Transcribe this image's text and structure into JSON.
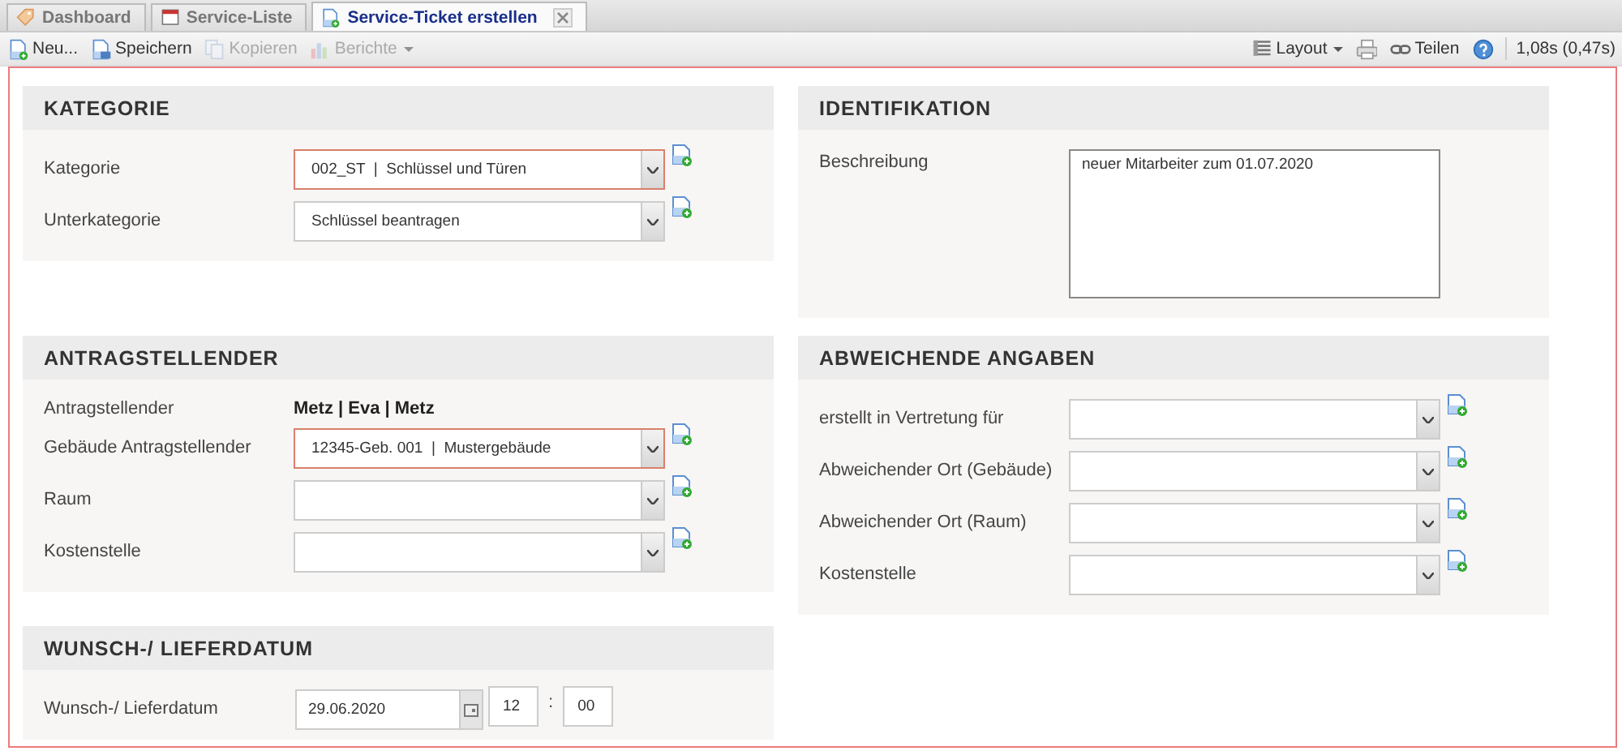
{
  "tabs": [
    {
      "label": "Dashboard",
      "selected": false,
      "kind": "tag"
    },
    {
      "label": "Service-Liste",
      "selected": false,
      "kind": "list"
    },
    {
      "label": "Service-Ticket erstellen",
      "selected": true,
      "kind": "new",
      "closable": true
    }
  ],
  "toolbar": {
    "left": [
      {
        "label": "Neu...",
        "kind": "new",
        "disabled": false,
        "dropdown": false
      },
      {
        "label": "Speichern",
        "kind": "save",
        "disabled": false,
        "dropdown": false
      },
      {
        "label": "Kopieren",
        "kind": "copy",
        "disabled": true,
        "dropdown": false
      },
      {
        "label": "Berichte",
        "kind": "chart",
        "disabled": true,
        "dropdown": true
      }
    ],
    "right": [
      {
        "label": "Layout",
        "kind": "layout",
        "disabled": false,
        "dropdown": true
      },
      {
        "kind": "print",
        "disabled": false,
        "dropdown": false
      },
      {
        "label": "Teilen",
        "kind": "link",
        "disabled": false,
        "dropdown": false
      },
      {
        "kind": "help",
        "disabled": false,
        "dropdown": false
      }
    ],
    "timing": "1,08s (0,47s)"
  },
  "form_rows": [
    [
      {
        "title": "KATEGORIE",
        "fields": [
          {
            "kind": "select",
            "label": "Kategorie",
            "value": "002_ST  |  Schlüssel und Türen",
            "required": true
          },
          {
            "kind": "select",
            "label": "Unterkategorie",
            "value": "Schlüssel beantragen",
            "required": false
          }
        ]
      },
      {
        "title": "IDENTIFIKATION",
        "fields": [
          {
            "kind": "textarea",
            "label": "Beschreibung",
            "value": "neuer Mitarbeiter zum 01.07.2020"
          }
        ]
      }
    ],
    [
      {
        "title": "ANTRAGSTELLENDER",
        "fields": [
          {
            "kind": "text",
            "label": "Antragstellender",
            "value": "Metz | Eva | Metz"
          },
          {
            "kind": "select",
            "label": "Gebäude Antragstellender",
            "value": "12345-Geb. 001  |  Mustergebäude",
            "required": true
          },
          {
            "kind": "select",
            "label": "Raum",
            "required": false
          },
          {
            "kind": "select",
            "label": "Kostenstelle",
            "required": false
          }
        ]
      },
      {
        "title": "ABWEICHENDE ANGABEN",
        "fields": [
          {
            "kind": "select",
            "label": "erstellt in Vertretung für",
            "required": false
          },
          {
            "kind": "select",
            "label": "Abweichender Ort (Gebäude)",
            "required": false
          },
          {
            "kind": "select",
            "label": "Abweichender Ort (Raum)",
            "required": false
          },
          {
            "kind": "select",
            "label": "Kostenstelle",
            "required": false
          }
        ]
      }
    ],
    [
      {
        "title": "WUNSCH-/ LIEFERDATUM",
        "fields": [
          {
            "kind": "datetime",
            "label": "Wunsch-/ Lieferdatum",
            "date": "29.06.2020",
            "hour": "12",
            "separator": ":",
            "minute": "00"
          }
        ]
      }
    ]
  ]
}
